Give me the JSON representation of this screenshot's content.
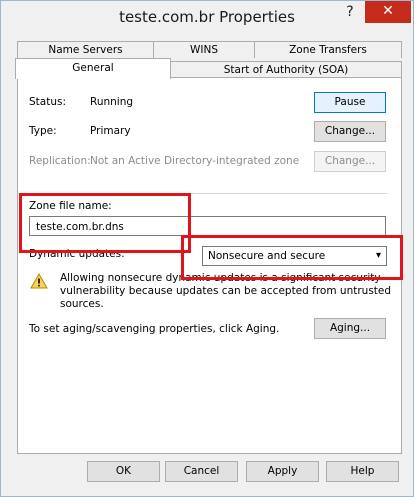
{
  "window": {
    "title": "teste.com.br Properties",
    "help_glyph": "?",
    "close_glyph": "✕"
  },
  "tabs_back": [
    {
      "label": "Name Servers"
    },
    {
      "label": "WINS"
    },
    {
      "label": "Zone Transfers"
    }
  ],
  "tabs_front": [
    {
      "label": "General",
      "active": true
    },
    {
      "label": "Start of Authority (SOA)",
      "active": false
    }
  ],
  "general": {
    "status_label": "Status:",
    "status_value": "Running",
    "pause_button": "Pause",
    "type_label": "Type:",
    "type_value": "Primary",
    "type_change_button": "Change...",
    "replication_label": "Replication:",
    "replication_value": "Not an Active Directory-integrated zone",
    "replication_change_button": "Change...",
    "zone_file_label": "Zone file name:",
    "zone_file_value": "teste.com.br.dns",
    "dynamic_updates_label": "Dynamic updates:",
    "dynamic_updates_value": "Nonsecure and secure",
    "warning_line1": "Allowing nonsecure dynamic updates is a significant security",
    "warning_line2": "vulnerability because updates can be accepted from untrusted",
    "warning_line3": "sources.",
    "aging_text": "To set aging/scavenging properties, click Aging.",
    "aging_button": "Aging..."
  },
  "footer": {
    "ok": "OK",
    "cancel": "Cancel",
    "apply": "Apply",
    "help": "Help"
  },
  "colors": {
    "highlight_box": "#e2141b",
    "close_button": "#c42b1c",
    "focus_blue": "#0078d7"
  },
  "icons": {
    "warning": "warning-triangle-icon",
    "dropdown": "chevron-down-icon"
  }
}
